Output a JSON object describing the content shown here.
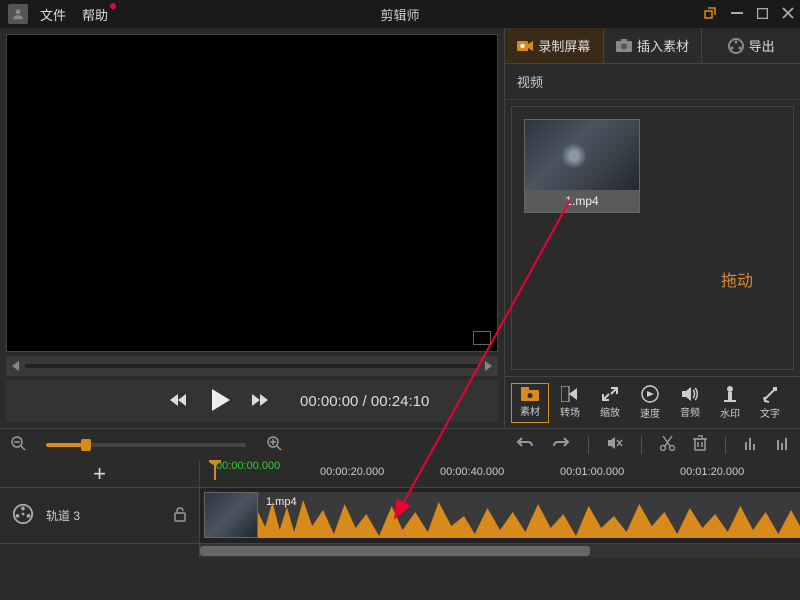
{
  "titlebar": {
    "menu_file": "文件",
    "menu_help": "帮助",
    "app_title": "剪辑师"
  },
  "right_tabs": {
    "record": "录制屏幕",
    "insert": "插入素材",
    "export": "导出"
  },
  "media": {
    "section": "视频",
    "items": [
      {
        "name": "1.mp4"
      }
    ],
    "drag_hint": "拖动"
  },
  "tools": {
    "material": "素材",
    "transition": "转场",
    "zoom": "缩放",
    "speed": "速度",
    "audio": "音频",
    "watermark": "水印",
    "text": "文字"
  },
  "playback": {
    "time_current": "00:00:00",
    "time_sep": " / ",
    "time_total": "00:24:10"
  },
  "timeline": {
    "playhead": "00:00:00.000",
    "marks": [
      "00:00:20.000",
      "00:00:40.000",
      "00:01:00.000",
      "00:01:20.000"
    ],
    "add": "+",
    "track_name": "轨道 3",
    "clip_name": "1.mp4"
  }
}
